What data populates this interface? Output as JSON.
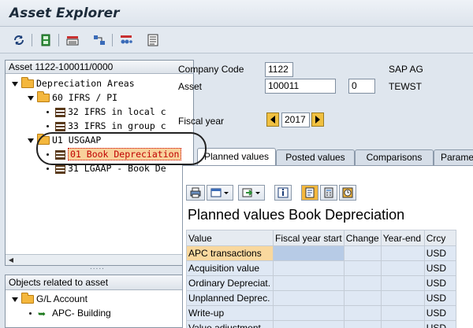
{
  "app": {
    "title": "Asset Explorer"
  },
  "toolbar": {
    "icons": [
      "refresh-icon",
      "save-icon",
      "display-icon",
      "structure-icon",
      "graphics-icon",
      "list-icon"
    ]
  },
  "tree": {
    "header": "Asset 1122-100011/0000",
    "items": [
      {
        "label": "Depreciation Areas"
      },
      {
        "label": "60 IFRS / PI"
      },
      {
        "label": "32 IFRS in local c"
      },
      {
        "label": "33 IFRS in group c"
      },
      {
        "label": "U1 USGAAP"
      },
      {
        "label": "01 Book Depreciation"
      },
      {
        "label": "31 LGAAP - Book De"
      }
    ]
  },
  "objects": {
    "header": "Objects related to asset",
    "items": [
      {
        "label": "G/L Account"
      },
      {
        "label": "APC- Building"
      }
    ]
  },
  "header_fields": {
    "company_code_label": "Company Code",
    "company_code_value": "1122",
    "company_name": "SAP AG",
    "asset_label": "Asset",
    "asset_value": "100011",
    "asset_sub": "0",
    "asset_desc": "TEWST",
    "fiscal_year_label": "Fiscal year",
    "fiscal_year_value": "2017"
  },
  "tabs": [
    {
      "label": "Planned values",
      "active": true
    },
    {
      "label": "Posted values",
      "active": false
    },
    {
      "label": "Comparisons",
      "active": false
    },
    {
      "label": "Parame",
      "active": false
    }
  ],
  "grid": {
    "title": "Planned values Book Depreciation",
    "columns": [
      "Value",
      "Fiscal year start",
      "Change",
      "Year-end",
      "Crcy"
    ],
    "rows": [
      {
        "value": "APC transactions",
        "start": "",
        "change": "",
        "end": "",
        "crcy": "USD"
      },
      {
        "value": "Acquisition value",
        "start": "",
        "change": "",
        "end": "",
        "crcy": "USD"
      },
      {
        "value": "Ordinary Depreciat.",
        "start": "",
        "change": "",
        "end": "",
        "crcy": "USD"
      },
      {
        "value": "Unplanned Deprec.",
        "start": "",
        "change": "",
        "end": "",
        "crcy": "USD"
      },
      {
        "value": "Write-up",
        "start": "",
        "change": "",
        "end": "",
        "crcy": "USD"
      },
      {
        "value": "Value adjustment",
        "start": "",
        "change": "",
        "end": "",
        "crcy": "USD"
      }
    ]
  },
  "colors": {
    "folder": "#f4b73d",
    "highlight_row": "#f9d89e",
    "change_col": "#f5f542",
    "yearend_col": "#b8f0a8"
  }
}
